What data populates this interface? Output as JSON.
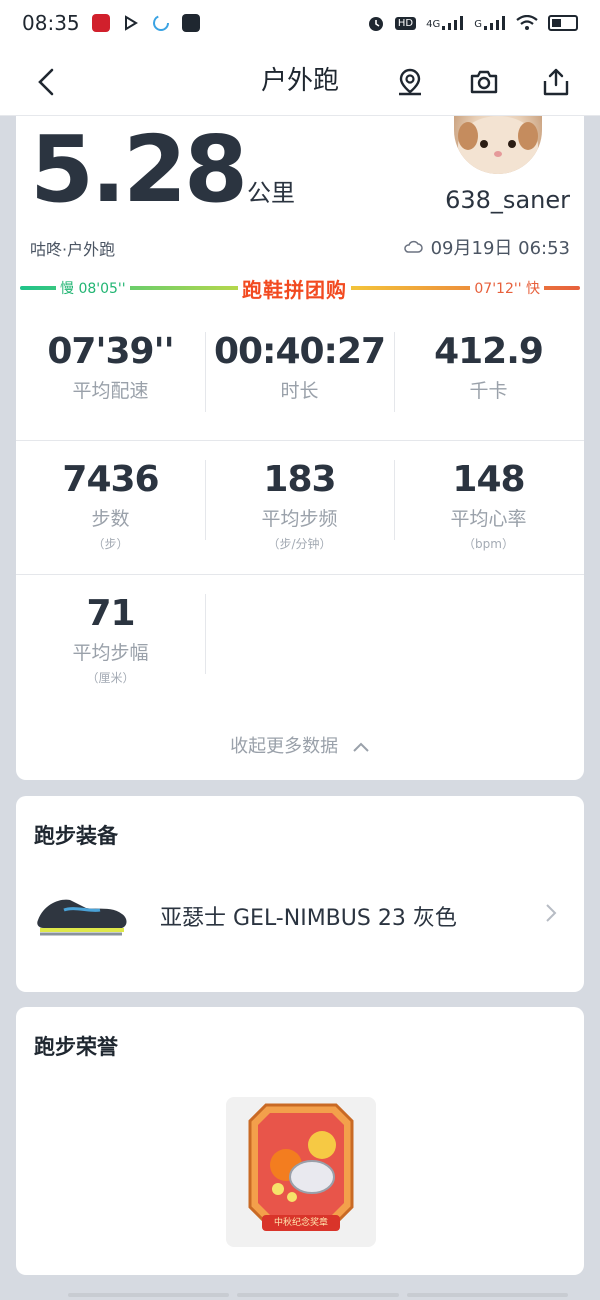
{
  "status_bar": {
    "time": "08:35",
    "network_1": "4G",
    "network_2": "G",
    "hd": "HD"
  },
  "header": {
    "title": "户外跑"
  },
  "summary": {
    "distance": "5.28",
    "distance_unit": "公里",
    "username": "638_saner",
    "subtitle": "咕咚·户外跑",
    "datetime": "09月19日 06:53",
    "pace_slow": "慢 08'05''",
    "pace_fast": "07'12'' 快",
    "promo": "跑鞋拼团购"
  },
  "stats": {
    "row1": [
      {
        "value": "07'39''",
        "label": "平均配速",
        "unit": ""
      },
      {
        "value": "00:40:27",
        "label": "时长",
        "unit": ""
      },
      {
        "value": "412.9",
        "label": "千卡",
        "unit": ""
      }
    ],
    "row2": [
      {
        "value": "7436",
        "label": "步数",
        "unit": "（步）"
      },
      {
        "value": "183",
        "label": "平均步频",
        "unit": "（步/分钟）"
      },
      {
        "value": "148",
        "label": "平均心率",
        "unit": "（bpm）"
      }
    ],
    "row3": [
      {
        "value": "71",
        "label": "平均步幅",
        "unit": "（厘米）"
      }
    ],
    "collapse_label": "收起更多数据"
  },
  "equipment": {
    "title": "跑步装备",
    "shoe_name": "亚瑟士 GEL-NIMBUS 23 灰色"
  },
  "honor": {
    "title": "跑步荣誉",
    "medal_text": "中秋纪念奖章"
  },
  "colors": {
    "pace_start": "#1fc38a",
    "pace_end": "#e7603c",
    "promo": "#f24a20"
  }
}
